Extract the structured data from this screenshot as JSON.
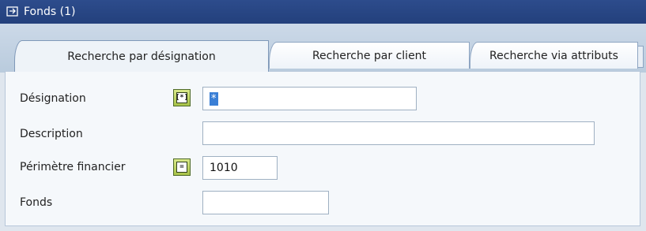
{
  "window": {
    "title": "Fonds (1)",
    "icon": "collapse-window-icon"
  },
  "tabs": [
    {
      "label": "Recherche par désignation",
      "active": true
    },
    {
      "label": "Recherche par client",
      "active": false
    },
    {
      "label": "Recherche via attributs",
      "active": false
    }
  ],
  "form": {
    "designation": {
      "label": "Désignation",
      "value": "*",
      "operator": "[*]",
      "operator_icon": "pattern-operator-icon"
    },
    "description": {
      "label": "Description",
      "value": ""
    },
    "perimetre": {
      "label": "Périmètre financier",
      "value": "1010",
      "operator": "=",
      "operator_icon": "equals-operator-icon"
    },
    "fonds": {
      "label": "Fonds",
      "value": ""
    }
  },
  "colors": {
    "titlebar": "#2d4c8c",
    "operator_button": "#b7cf55",
    "selection": "#3a7fd6"
  }
}
